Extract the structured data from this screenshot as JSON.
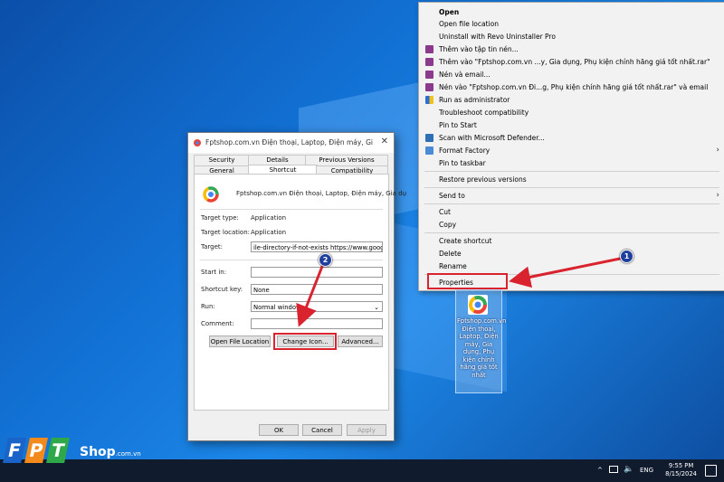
{
  "context_menu": {
    "items": [
      {
        "label": "Open",
        "bold": true
      },
      {
        "label": "Open file location"
      },
      {
        "label": "Uninstall with Revo Uninstaller Pro"
      },
      {
        "label": "Thêm vào tập tin nén..."
      },
      {
        "label": "Thêm vào \"Fptshop.com.vn ...y, Gia dụng, Phụ kiện chính hãng giá tốt nhất.rar\""
      },
      {
        "label": "Nén và email..."
      },
      {
        "label": "Nén vào \"Fptshop.com.vn Đi...g, Phụ kiện chính hãng giá tốt nhất.rar\" và email"
      },
      {
        "label": "Run as administrator"
      },
      {
        "label": "Troubleshoot compatibility"
      },
      {
        "label": "Pin to Start"
      },
      {
        "label": "Scan with Microsoft Defender..."
      },
      {
        "label": "Format Factory"
      },
      {
        "label": "Pin to taskbar"
      },
      {
        "label": "Restore previous versions"
      },
      {
        "label": "Send to"
      },
      {
        "label": "Cut"
      },
      {
        "label": "Copy"
      },
      {
        "label": "Create shortcut"
      },
      {
        "label": "Delete"
      },
      {
        "label": "Rename"
      },
      {
        "label": "Properties"
      }
    ]
  },
  "desktop_icon": {
    "caption": "Fptshop.com.vn Điện thoại, Laptop, Điện máy, Gia dụng, Phụ kiện chính hãng giá tốt nhất"
  },
  "dialog": {
    "title": "Fptshop.com.vn  Điện thoại, Laptop, Điện máy, Gia dụ...",
    "tabs_row1": [
      "Security",
      "Details",
      "Previous Versions"
    ],
    "tabs_row2": [
      "General",
      "Shortcut",
      "Compatibility"
    ],
    "name": "Fptshop.com.vn  Điện thoại, Laptop, Điện máy, Gia dụ",
    "target_type_label": "Target type:",
    "target_type_value": "Application",
    "target_location_label": "Target location:",
    "target_location_value": "Application",
    "target_label": "Target:",
    "target_value": "ile-directory-if-not-exists https://www.google.com/",
    "start_in_label": "Start in:",
    "start_in_value": "",
    "shortcut_key_label": "Shortcut key:",
    "shortcut_key_value": "None",
    "run_label": "Run:",
    "run_value": "Normal window",
    "comment_label": "Comment:",
    "comment_value": "",
    "open_file_location": "Open File Location",
    "change_icon": "Change Icon...",
    "advanced": "Advanced...",
    "ok": "OK",
    "cancel": "Cancel",
    "apply": "Apply"
  },
  "markers": [
    "1",
    "2"
  ],
  "taskbar": {
    "language": "ENG",
    "time": "9:55 PM",
    "date": "8/15/2024",
    "chevron": "^"
  },
  "logo": {
    "letters": [
      "F",
      "P",
      "T"
    ],
    "shop": "Shop",
    "suffix": ".com.vn"
  },
  "colors": {
    "highlight_red": "#d9232e",
    "marker_blue": "#1f3f9e",
    "fpt_blue": "#1a63c9",
    "fpt_orange": "#f28a1c",
    "fpt_green": "#2fa84a"
  }
}
